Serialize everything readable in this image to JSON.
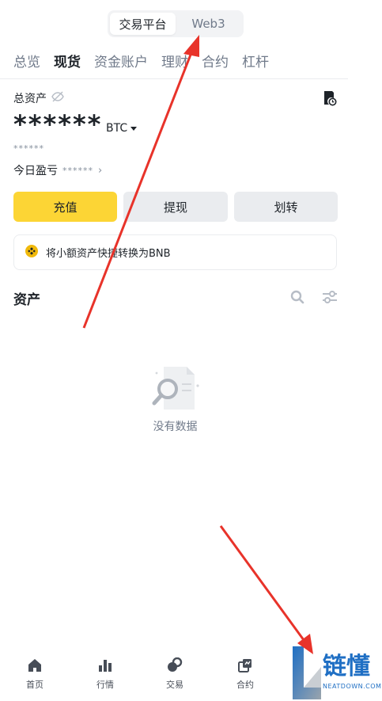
{
  "header": {
    "switch": [
      {
        "label": "交易平台",
        "active": true
      },
      {
        "label": "Web3",
        "active": false
      }
    ]
  },
  "tabs": [
    {
      "label": "总览",
      "active": false
    },
    {
      "label": "现货",
      "active": true
    },
    {
      "label": "资金账户",
      "active": false
    },
    {
      "label": "理财",
      "active": false
    },
    {
      "label": "合约",
      "active": false
    },
    {
      "label": "杠杆",
      "active": false
    }
  ],
  "balance": {
    "label": "总资产",
    "value": "******",
    "unit": "BTC",
    "sub_value": "******",
    "pnl_label": "今日盈亏",
    "pnl_value": "******"
  },
  "actions": {
    "deposit": "充值",
    "withdraw": "提现",
    "transfer": "划转"
  },
  "banner": {
    "text": "将小额资产快捷转换为BNB"
  },
  "assets": {
    "title": "资产",
    "empty_text": "没有数据"
  },
  "bottom_nav": [
    {
      "label": "首页",
      "icon": "home-icon"
    },
    {
      "label": "行情",
      "icon": "markets-icon"
    },
    {
      "label": "交易",
      "icon": "trade-icon"
    },
    {
      "label": "合约",
      "icon": "futures-icon"
    }
  ],
  "watermark": {
    "brand": "链懂",
    "domain": "NEATDOWN.COM"
  },
  "colors": {
    "accent": "#fcd535",
    "annotation": "#e8332a"
  }
}
